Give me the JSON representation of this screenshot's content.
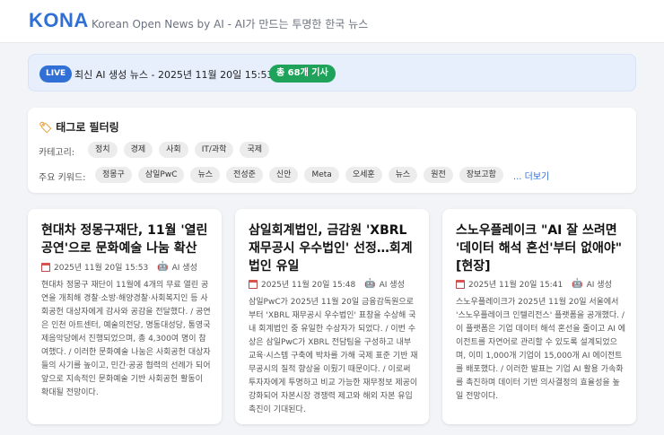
{
  "header": {
    "logo": "KONA",
    "tagline": "Korean Open News by AI - AI가 만드는 투명한 한국 뉴스"
  },
  "live": {
    "badge": "LIVE",
    "text": "최신 AI 생성 뉴스 - 2025년 11월 20일 15:53 업데이트",
    "count": "총 68개 기사"
  },
  "filter": {
    "title": "태그로 필터링",
    "category_label": "카테고리:",
    "categories": [
      "정치",
      "경제",
      "사회",
      "IT/과학",
      "국제"
    ],
    "keyword_label": "주요 키워드:",
    "keywords": [
      "정몽구",
      "삼일PwC",
      "뉴스",
      "전성준",
      "신안",
      "Meta",
      "오세훈",
      "뉴스",
      "원전",
      "장보고함"
    ],
    "more": "... 더보기"
  },
  "articles": [
    {
      "title": "현대차 정몽구재단, 11월 '열린 공연'으로 문화예술 나눔 확산",
      "date": "2025년 11월 20일 15:53",
      "ai": "AI 생성",
      "body": "현대차 정몽구 재단이 11월에 4개의 무료 열린 공연을 개최해 경찰·소방·해양경찰·사회복지인 등 사회공헌 대상자에게 감사와 공감을 전달했다. / 공연은 인천 아트센터, 예술의전당, 명동대성당, 통영국제음악당에서 진행되었으며, 총 4,300여 명이 참여했다. / 이러한 문화예술 나눔은 사회공헌 대상자들의 사기를 높이고, 민간·공공 협력의 선례가 되어 앞으로 지속적인 문화예술 기반 사회공헌 활동이 확대될 전망이다."
    },
    {
      "title": "삼일회계법인, 금감원 'XBRL 재무공시 우수법인' 선정…회계법인 유일",
      "date": "2025년 11월 20일 15:48",
      "ai": "AI 생성",
      "body": "삼일PwC가 2025년 11월 20일 금융감독원으로부터 'XBRL 재무공시 우수법인' 표창을 수상해 국내 회계법인 중 유일한 수상자가 되었다. / 이번 수상은 삼일PwC가 XBRL 전담팀을 구성하고 내부 교육·시스템 구축에 박차를 가해 국제 표준 기반 재무공시의 질적 향상을 이뤘기 때문이다. / 이로써 투자자에게 투명하고 비교 가능한 재무정보 제공이 강화되어 자본시장 경쟁력 제고와 해외 자본 유입 촉진이 기대된다."
    },
    {
      "title": "스노우플레이크 \"AI 잘 쓰려면 '데이터 해석 혼선'부터 없애야\"[현장]",
      "date": "2025년 11월 20일 15:41",
      "ai": "AI 생성",
      "body": "스노우플레이크가 2025년 11월 20일 서울에서 '스노우플레이크 인텔리전스' 플랫폼을 공개했다. / 이 플랫폼은 기업 데이터 해석 혼선을 줄이고 AI 에이전트를 자연어로 관리할 수 있도록 설계되었으며, 이미 1,000개 기업이 15,000개 AI 에이전트를 배포했다. / 이러한 발표는 기업 AI 활용 가속화를 촉진하며 데이터 기반 의사결정의 효율성을 높일 전망이다."
    }
  ]
}
